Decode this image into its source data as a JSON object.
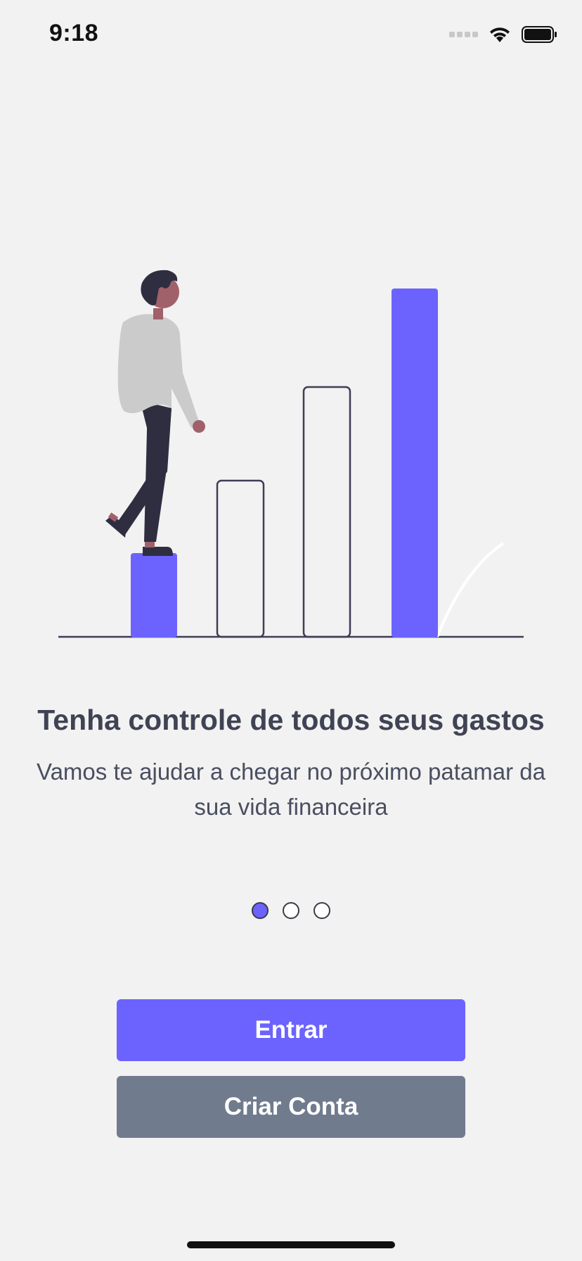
{
  "status_bar": {
    "time": "9:18",
    "icons": [
      "signal-icon",
      "wifi-icon",
      "battery-icon"
    ]
  },
  "illustration": {
    "name": "growth-chart-illustration",
    "colors": {
      "accent": "#6c63ff",
      "outline": "#3f3d56",
      "person_shirt": "#cbcbcb",
      "person_pants": "#2f2e41",
      "person_skin": "#a0616a"
    }
  },
  "onboarding": {
    "title": "Tenha controle de todos seus gastos",
    "subtitle": "Vamos te ajudar a chegar no próximo patamar da sua vida financeira"
  },
  "pager": {
    "total": 3,
    "active_index": 0
  },
  "actions": {
    "login_label": "Entrar",
    "signup_label": "Criar Conta"
  },
  "theme": {
    "primary": "#6c63ff",
    "secondary": "#717b8e",
    "background": "#f2f2f2",
    "text": "#3f4354"
  }
}
